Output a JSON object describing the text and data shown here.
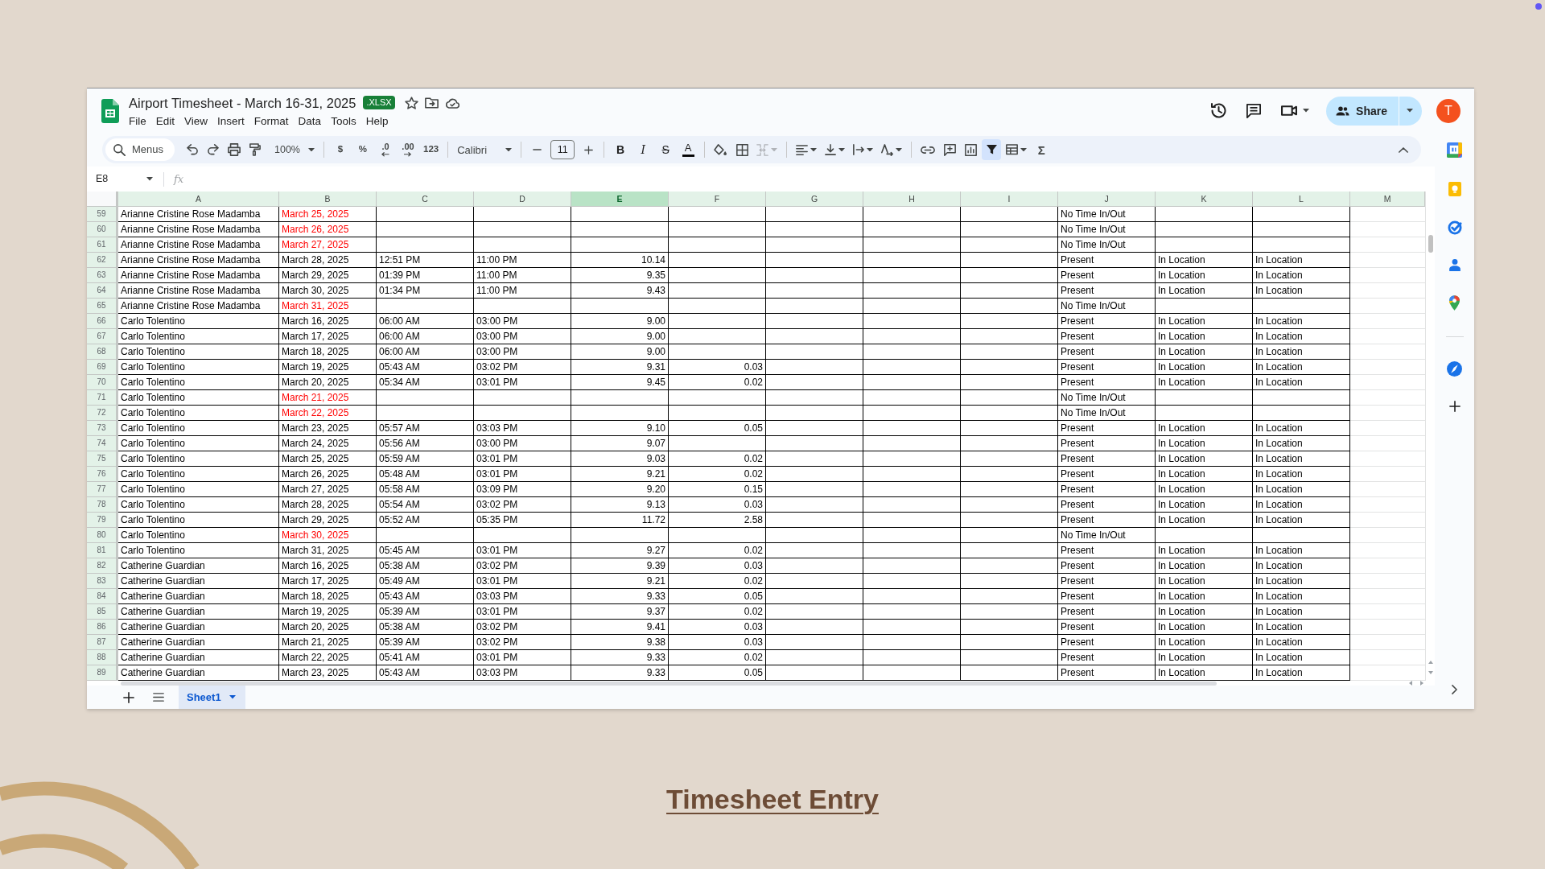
{
  "window": {
    "title": "Airport Timesheet - March 16-31, 2025",
    "file_badge": ".XLSX",
    "menu": [
      "File",
      "Edit",
      "View",
      "Insert",
      "Format",
      "Data",
      "Tools",
      "Help"
    ],
    "share_label": "Share",
    "avatar_initial": "T"
  },
  "toolbar": {
    "search": {
      "placeholder": "Menus"
    },
    "zoom": "100%",
    "number_formats": [
      {
        "kind": "plain",
        "label": "$"
      },
      {
        "kind": "plain",
        "label": "%"
      },
      {
        "kind": "decrease",
        "label": ".0"
      },
      {
        "kind": "increase",
        "label": ".00"
      },
      {
        "kind": "plain",
        "label": "123"
      }
    ],
    "font": "Calibri",
    "font_size": "11",
    "text_styles": [
      {
        "kind": "bold",
        "label": "B"
      },
      {
        "kind": "italic",
        "label": "I"
      },
      {
        "kind": "strikethrough",
        "label": "S"
      },
      {
        "kind": "color",
        "label": "A"
      }
    ],
    "filter_on": true,
    "functions_label": "Σ"
  },
  "formula_bar": {
    "cell_ref": "E8",
    "fx_label": "fx"
  },
  "sheet": {
    "columns": [
      {
        "label": "A",
        "selected": false
      },
      {
        "label": "B",
        "selected": false
      },
      {
        "label": "C",
        "selected": false
      },
      {
        "label": "D",
        "selected": false
      },
      {
        "label": "E",
        "selected": true
      },
      {
        "label": "F",
        "selected": false
      },
      {
        "label": "G",
        "selected": false
      },
      {
        "label": "H",
        "selected": false
      },
      {
        "label": "I",
        "selected": false
      },
      {
        "label": "J",
        "selected": false
      },
      {
        "label": "K",
        "selected": false
      },
      {
        "label": "L",
        "selected": false
      },
      {
        "label": "M",
        "selected": false
      }
    ],
    "rows": [
      {
        "number": "59",
        "color": "#ff0000",
        "cells": {
          "A": "Arianne Cristine Rose Madamba",
          "B": "March 25, 2025",
          "J": "No Time In/Out"
        }
      },
      {
        "number": "60",
        "color": "#ff0000",
        "cells": {
          "A": "Arianne Cristine Rose Madamba",
          "B": "March 26, 2025",
          "J": "No Time In/Out"
        }
      },
      {
        "number": "61",
        "color": "#ff0000",
        "cells": {
          "A": "Arianne Cristine Rose Madamba",
          "B": "March 27, 2025",
          "J": "No Time In/Out"
        }
      },
      {
        "number": "62",
        "color": "#000000",
        "cells": {
          "A": "Arianne Cristine Rose Madamba",
          "B": "March 28, 2025",
          "C": "12:51 PM",
          "D": "11:00 PM",
          "E": "10.14",
          "J": "Present",
          "K": "In Location",
          "L": "In Location"
        }
      },
      {
        "number": "63",
        "color": "#000000",
        "cells": {
          "A": "Arianne Cristine Rose Madamba",
          "B": "March 29, 2025",
          "C": "01:39 PM",
          "D": "11:00 PM",
          "E": "9.35",
          "J": "Present",
          "K": "In Location",
          "L": "In Location"
        }
      },
      {
        "number": "64",
        "color": "#000000",
        "cells": {
          "A": "Arianne Cristine Rose Madamba",
          "B": "March 30, 2025",
          "C": "01:34 PM",
          "D": "11:00 PM",
          "E": "9.43",
          "J": "Present",
          "K": "In Location",
          "L": "In Location"
        }
      },
      {
        "number": "65",
        "color": "#ff0000",
        "cells": {
          "A": "Arianne Cristine Rose Madamba",
          "B": "March 31, 2025",
          "J": "No Time In/Out"
        }
      },
      {
        "number": "66",
        "color": "#000000",
        "cells": {
          "A": "Carlo Tolentino",
          "B": "March 16, 2025",
          "C": "06:00 AM",
          "D": "03:00 PM",
          "E": "9.00",
          "J": "Present",
          "K": "In Location",
          "L": "In Location"
        }
      },
      {
        "number": "67",
        "color": "#000000",
        "cells": {
          "A": "Carlo Tolentino",
          "B": "March 17, 2025",
          "C": "06:00 AM",
          "D": "03:00 PM",
          "E": "9.00",
          "J": "Present",
          "K": "In Location",
          "L": "In Location"
        }
      },
      {
        "number": "68",
        "color": "#000000",
        "cells": {
          "A": "Carlo Tolentino",
          "B": "March 18, 2025",
          "C": "06:00 AM",
          "D": "03:00 PM",
          "E": "9.00",
          "J": "Present",
          "K": "In Location",
          "L": "In Location"
        }
      },
      {
        "number": "69",
        "color": "#000000",
        "cells": {
          "A": "Carlo Tolentino",
          "B": "March 19, 2025",
          "C": "05:43 AM",
          "D": "03:02 PM",
          "E": "9.31",
          "F": "0.03",
          "J": "Present",
          "K": "In Location",
          "L": "In Location"
        }
      },
      {
        "number": "70",
        "color": "#000000",
        "cells": {
          "A": "Carlo Tolentino",
          "B": "March 20, 2025",
          "C": "05:34 AM",
          "D": "03:01 PM",
          "E": "9.45",
          "F": "0.02",
          "J": "Present",
          "K": "In Location",
          "L": "In Location"
        }
      },
      {
        "number": "71",
        "color": "#ff0000",
        "cells": {
          "A": "Carlo Tolentino",
          "B": "March 21, 2025",
          "J": "No Time In/Out"
        }
      },
      {
        "number": "72",
        "color": "#ff0000",
        "cells": {
          "A": "Carlo Tolentino",
          "B": "March 22, 2025",
          "J": "No Time In/Out"
        }
      },
      {
        "number": "73",
        "color": "#000000",
        "cells": {
          "A": "Carlo Tolentino",
          "B": "March 23, 2025",
          "C": "05:57 AM",
          "D": "03:03 PM",
          "E": "9.10",
          "F": "0.05",
          "J": "Present",
          "K": "In Location",
          "L": "In Location"
        }
      },
      {
        "number": "74",
        "color": "#000000",
        "cells": {
          "A": "Carlo Tolentino",
          "B": "March 24, 2025",
          "C": "05:56 AM",
          "D": "03:00 PM",
          "E": "9.07",
          "J": "Present",
          "K": "In Location",
          "L": "In Location"
        }
      },
      {
        "number": "75",
        "color": "#000000",
        "cells": {
          "A": "Carlo Tolentino",
          "B": "March 25, 2025",
          "C": "05:59 AM",
          "D": "03:01 PM",
          "E": "9.03",
          "F": "0.02",
          "J": "Present",
          "K": "In Location",
          "L": "In Location"
        }
      },
      {
        "number": "76",
        "color": "#000000",
        "cells": {
          "A": "Carlo Tolentino",
          "B": "March 26, 2025",
          "C": "05:48 AM",
          "D": "03:01 PM",
          "E": "9.21",
          "F": "0.02",
          "J": "Present",
          "K": "In Location",
          "L": "In Location"
        }
      },
      {
        "number": "77",
        "color": "#000000",
        "cells": {
          "A": "Carlo Tolentino",
          "B": "March 27, 2025",
          "C": "05:58 AM",
          "D": "03:09 PM",
          "E": "9.20",
          "F": "0.15",
          "J": "Present",
          "K": "In Location",
          "L": "In Location"
        }
      },
      {
        "number": "78",
        "color": "#000000",
        "cells": {
          "A": "Carlo Tolentino",
          "B": "March 28, 2025",
          "C": "05:54 AM",
          "D": "03:02 PM",
          "E": "9.13",
          "F": "0.03",
          "J": "Present",
          "K": "In Location",
          "L": "In Location"
        }
      },
      {
        "number": "79",
        "color": "#000000",
        "cells": {
          "A": "Carlo Tolentino",
          "B": "March 29, 2025",
          "C": "05:52 AM",
          "D": "05:35 PM",
          "E": "11.72",
          "F": "2.58",
          "J": "Present",
          "K": "In Location",
          "L": "In Location"
        }
      },
      {
        "number": "80",
        "color": "#ff0000",
        "cells": {
          "A": "Carlo Tolentino",
          "B": "March 30, 2025",
          "J": "No Time In/Out"
        }
      },
      {
        "number": "81",
        "color": "#000000",
        "cells": {
          "A": "Carlo Tolentino",
          "B": "March 31, 2025",
          "C": "05:45 AM",
          "D": "03:01 PM",
          "E": "9.27",
          "F": "0.02",
          "J": "Present",
          "K": "In Location",
          "L": "In Location"
        }
      },
      {
        "number": "82",
        "color": "#000000",
        "cells": {
          "A": "Catherine Guardian",
          "B": "March 16, 2025",
          "C": "05:38 AM",
          "D": "03:02 PM",
          "E": "9.39",
          "F": "0.03",
          "J": "Present",
          "K": "In Location",
          "L": "In Location"
        }
      },
      {
        "number": "83",
        "color": "#000000",
        "cells": {
          "A": "Catherine Guardian",
          "B": "March 17, 2025",
          "C": "05:49 AM",
          "D": "03:01 PM",
          "E": "9.21",
          "F": "0.02",
          "J": "Present",
          "K": "In Location",
          "L": "In Location"
        }
      },
      {
        "number": "84",
        "color": "#000000",
        "cells": {
          "A": "Catherine Guardian",
          "B": "March 18, 2025",
          "C": "05:43 AM",
          "D": "03:03 PM",
          "E": "9.33",
          "F": "0.05",
          "J": "Present",
          "K": "In Location",
          "L": "In Location"
        }
      },
      {
        "number": "85",
        "color": "#000000",
        "cells": {
          "A": "Catherine Guardian",
          "B": "March 19, 2025",
          "C": "05:39 AM",
          "D": "03:01 PM",
          "E": "9.37",
          "F": "0.02",
          "J": "Present",
          "K": "In Location",
          "L": "In Location"
        }
      },
      {
        "number": "86",
        "color": "#000000",
        "cells": {
          "A": "Catherine Guardian",
          "B": "March 20, 2025",
          "C": "05:38 AM",
          "D": "03:02 PM",
          "E": "9.41",
          "F": "0.03",
          "J": "Present",
          "K": "In Location",
          "L": "In Location"
        }
      },
      {
        "number": "87",
        "color": "#000000",
        "cells": {
          "A": "Catherine Guardian",
          "B": "March 21, 2025",
          "C": "05:39 AM",
          "D": "03:02 PM",
          "E": "9.38",
          "F": "0.03",
          "J": "Present",
          "K": "In Location",
          "L": "In Location"
        }
      },
      {
        "number": "88",
        "color": "#000000",
        "cells": {
          "A": "Catherine Guardian",
          "B": "March 22, 2025",
          "C": "05:41 AM",
          "D": "03:01 PM",
          "E": "9.33",
          "F": "0.02",
          "J": "Present",
          "K": "In Location",
          "L": "In Location"
        }
      },
      {
        "number": "89",
        "color": "#000000",
        "cells": {
          "A": "Catherine Guardian",
          "B": "March 23, 2025",
          "C": "05:43 AM",
          "D": "03:03 PM",
          "E": "9.33",
          "F": "0.05",
          "J": "Present",
          "K": "In Location",
          "L": "In Location"
        }
      }
    ]
  },
  "sheet_tabs": [
    {
      "label": "Sheet1",
      "selected": true
    }
  ],
  "caption": "Timesheet Entry"
}
